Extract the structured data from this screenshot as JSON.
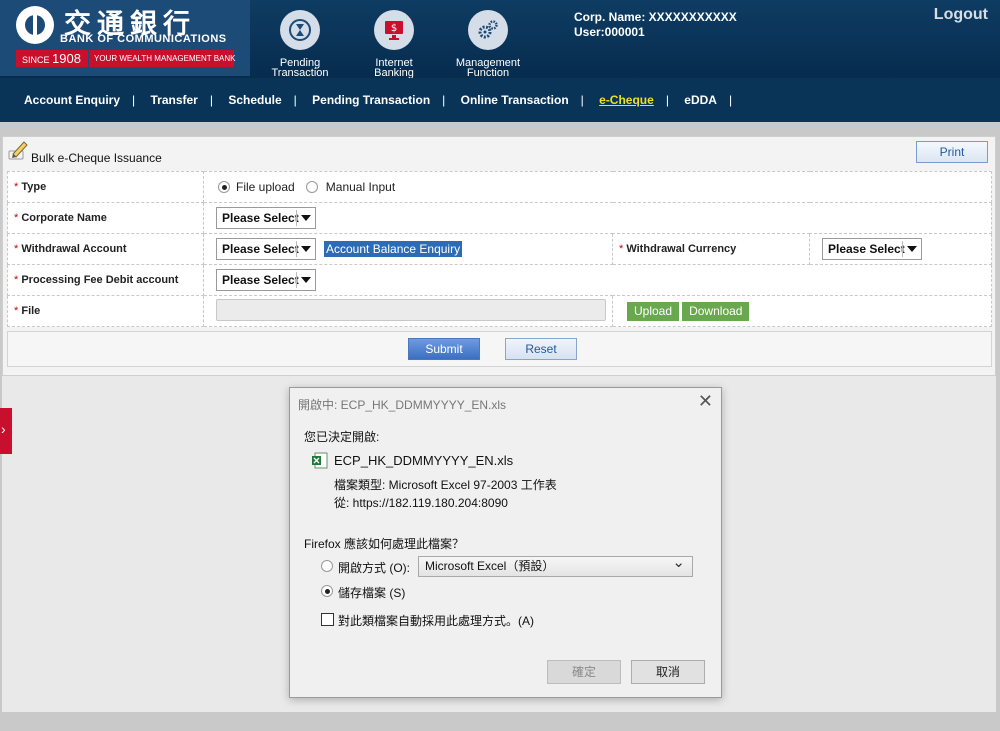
{
  "header": {
    "logo_cn": "交通銀行",
    "logo_en": "BANK OF COMMUNICATIONS",
    "since": "SINCE",
    "since_year": "1908",
    "tagline": "YOUR WEALTH MANAGEMENT BANK",
    "icons": [
      {
        "label": "Pending\nTransaction",
        "line1": "Pending",
        "line2": "Transaction",
        "icon": "hourglass-icon",
        "color": "#d4dde8"
      },
      {
        "label": "Internet Banking",
        "line1": "Internet",
        "line2": "Banking",
        "icon": "monitor-dollar-icon",
        "color": "#c8102e"
      },
      {
        "label": "Management Function",
        "line1": "Management",
        "line2": "Function",
        "icon": "gears-icon",
        "color": "#d4dde8"
      }
    ],
    "corp_name": "Corp. Name: XXXXXXXXXXX",
    "user": "User:000001",
    "logout": "Logout"
  },
  "nav": {
    "items": [
      "Account Enquiry",
      "Transfer",
      "Schedule",
      "Pending Transaction",
      "Online Transaction",
      "e-Cheque",
      "eDDA"
    ],
    "active": "e-Cheque",
    "separator": "|"
  },
  "form": {
    "title": "Bulk e-Cheque Issuance",
    "print": "Print",
    "required_mark": "*",
    "type_label": "Type",
    "type_options": [
      "File upload",
      "Manual Input"
    ],
    "type_selected": "File upload",
    "corporate_name_label": "Corporate Name",
    "withdrawal_account_label": "Withdrawal Account",
    "account_balance_link": "Account Balance Enquiry",
    "withdrawal_currency_label": "Withdrawal Currency",
    "processing_fee_label": "Processing Fee Debit account",
    "file_label": "File",
    "please_select": "Please Select",
    "upload": "Upload",
    "download": "Download",
    "submit": "Submit",
    "reset": "Reset"
  },
  "side_tab": {
    "glyph": "›"
  },
  "dialog": {
    "title": "開啟中: ECP_HK_DDMMYYYY_EN.xls",
    "close": "✕",
    "decided": "您已決定開啟:",
    "filename": "ECP_HK_DDMMYYYY_EN.xls",
    "file_type": "檔案類型:  Microsoft Excel 97-2003 工作表",
    "from": "從:  https://182.119.180.204:8090",
    "question": "Firefox 應該如何處理此檔案？",
    "open_with_label": "開啟方式 (O):",
    "open_with_value": "Microsoft Excel（預設）",
    "save_file_label": "儲存檔案 (S)",
    "selected_option": "save",
    "auto_label": "對此類檔案自動採用此處理方式。(A)",
    "ok": "確定",
    "cancel": "取消"
  }
}
